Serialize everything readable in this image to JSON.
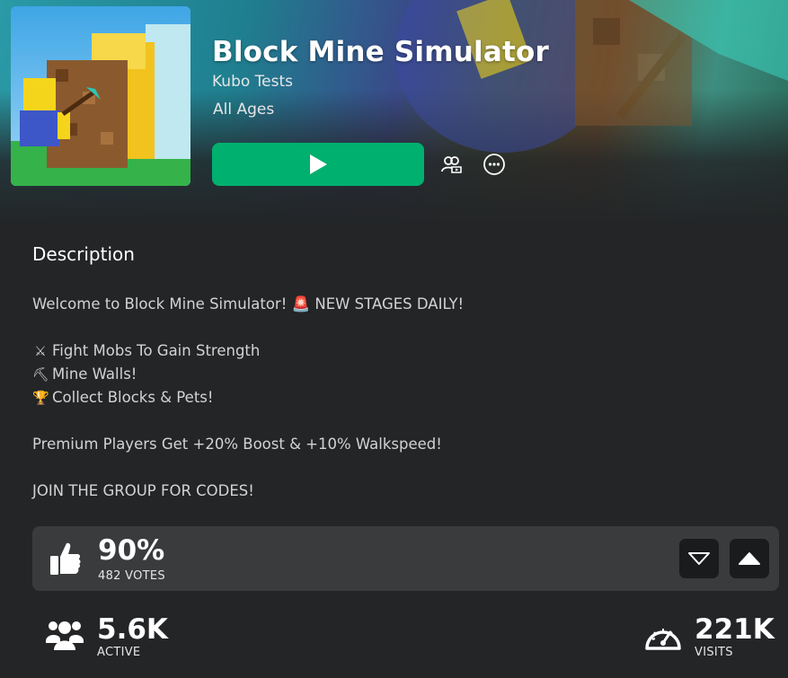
{
  "game": {
    "title": "Block Mine Simulator",
    "creator": "Kubo Tests",
    "age_rating": "All Ages"
  },
  "actions": {
    "play_icon": "play-icon",
    "party_icon": "party-icon",
    "more_icon": "more-options-icon"
  },
  "description": {
    "heading": "Description",
    "line1": "Welcome to Block Mine Simulator! 🚨 NEW STAGES DAILY!",
    "item1": "Fight Mobs To Gain Strength",
    "item2": "Mine Walls!",
    "item3": "Collect Blocks & Pets!",
    "premium": "Premium Players Get +20% Boost & +10% Walkspeed!",
    "group": "JOIN THE GROUP FOR CODES!"
  },
  "rating": {
    "percent": "90%",
    "votes": "482 VOTES"
  },
  "stats": {
    "active_value": "5.6K",
    "active_label": "ACTIVE",
    "visits_value": "221K",
    "visits_label": "VISITS"
  },
  "colors": {
    "background": "#232527",
    "play": "#00b06f",
    "card": "#393b3d"
  }
}
